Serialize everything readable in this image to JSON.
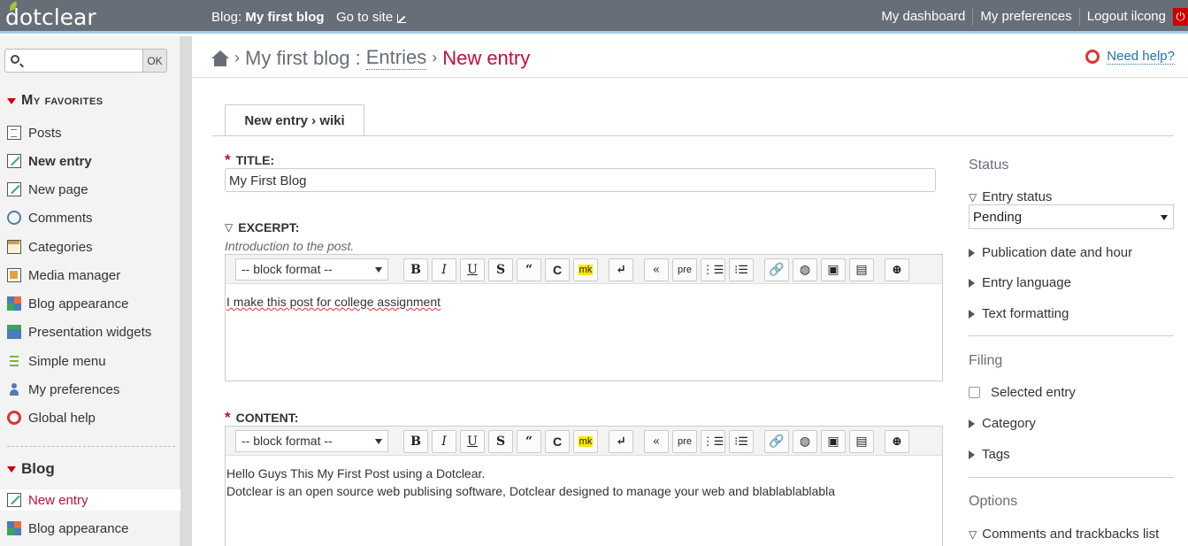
{
  "topbar": {
    "logo": "dotclear",
    "blog_prefix": "Blog:",
    "blog_name": "My first blog",
    "go_to_site": "Go to site",
    "links": [
      "My dashboard",
      "My preferences",
      "Logout ilcong"
    ],
    "logout_color": "#cc0000"
  },
  "sidebar": {
    "search_placeholder": "",
    "ok_label": "OK",
    "favorites_title": "My favorites",
    "favorites": [
      {
        "label": "Posts",
        "icon": "posts-icon"
      },
      {
        "label": "New entry",
        "icon": "edit-icon"
      },
      {
        "label": "New page",
        "icon": "page-icon"
      },
      {
        "label": "Comments",
        "icon": "comments-icon"
      },
      {
        "label": "Categories",
        "icon": "categories-icon"
      },
      {
        "label": "Media manager",
        "icon": "media-icon"
      },
      {
        "label": "Blog appearance",
        "icon": "appearance-icon"
      },
      {
        "label": "Presentation widgets",
        "icon": "widgets-icon"
      },
      {
        "label": "Simple menu",
        "icon": "menu-icon"
      },
      {
        "label": "My preferences",
        "icon": "user-icon"
      },
      {
        "label": "Global help",
        "icon": "help-icon"
      }
    ],
    "blog_title": "Blog",
    "blog_items": [
      {
        "label": "New entry",
        "icon": "edit-icon"
      },
      {
        "label": "Blog appearance",
        "icon": "appearance-icon"
      }
    ]
  },
  "breadcrumb": {
    "blog": "My first blog",
    "sep_colon": ":",
    "entries": "Entries",
    "current": "New entry"
  },
  "help": {
    "label": "Need help?"
  },
  "tab": {
    "label": "New entry › wiki"
  },
  "form": {
    "title_label": "TITLE:",
    "title_value": "My First Blog",
    "excerpt_label": "EXCERPT:",
    "excerpt_hint": "Introduction to the post.",
    "excerpt_text": "I make this post for college assignment",
    "content_label": "CONTENT:",
    "content_line1": "Hello Guys This My First Post using a Dotclear.",
    "content_line2": "Dotclear is an open source web publising software, Dotclear designed to manage your web and blablablablabla",
    "block_format": "-- block format --",
    "toolbar": {
      "bold": "B",
      "italic": "I",
      "underline": "U",
      "strike": "S",
      "quote": "“",
      "code": "C",
      "mark": "mk",
      "br": "↵",
      "blockquote": "«",
      "pre": "pre",
      "ul": "ul",
      "ol": "ol",
      "link": "link",
      "external": "ext",
      "image": "img",
      "doc": "doc",
      "more": "+"
    }
  },
  "right": {
    "status_head": "Status",
    "entry_status_label": "Entry status",
    "entry_status_value": "Pending",
    "pub_date": "Publication date and hour",
    "entry_lang": "Entry language",
    "text_format": "Text formatting",
    "filing_head": "Filing",
    "selected_entry": "Selected entry",
    "category": "Category",
    "tags": "Tags",
    "options_head": "Options",
    "comments_trackbacks": "Comments and trackbacks list"
  }
}
